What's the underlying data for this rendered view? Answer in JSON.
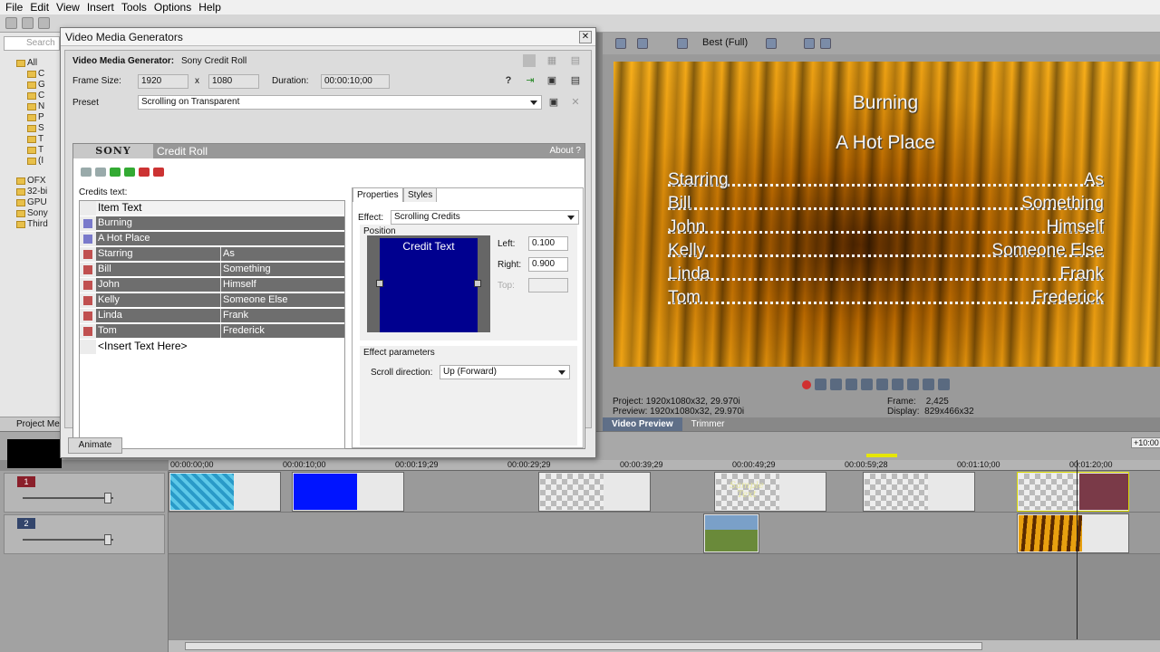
{
  "menu": [
    "File",
    "Edit",
    "View",
    "Insert",
    "Tools",
    "Options",
    "Help"
  ],
  "explorer": {
    "search_placeholder": "Search",
    "items": [
      "All",
      "C",
      "G",
      "C",
      "N",
      "P",
      "S",
      "T",
      "T",
      "(I",
      "OFX",
      "32-bi",
      "GPU",
      "Sony",
      "Third"
    ],
    "tab": "Project Me"
  },
  "dialog": {
    "title": "Video Media Generators",
    "generator_label": "Video Media Generator:",
    "generator_name": "Sony Credit Roll",
    "frame_size_label": "Frame Size:",
    "frame_w": "1920",
    "x_label": "x",
    "frame_h": "1080",
    "duration_label": "Duration:",
    "duration": "00:00:10;00",
    "preset_label": "Preset",
    "preset": "Scrolling on Transparent",
    "sony_logo": "SONY",
    "plugin_name": "Credit Roll",
    "about": "About ?",
    "credits_text_label": "Credits text:",
    "credits_header": "Item Text",
    "credits": [
      {
        "type": "title",
        "text": "Burning"
      },
      {
        "type": "title",
        "text": "A Hot Place"
      },
      {
        "type": "pair",
        "left": "Starring",
        "right": "As"
      },
      {
        "type": "pair",
        "left": "Bill",
        "right": "Something"
      },
      {
        "type": "pair",
        "left": "John",
        "right": "Himself"
      },
      {
        "type": "pair",
        "left": "Kelly",
        "right": "Someone Else"
      },
      {
        "type": "pair",
        "left": "Linda",
        "right": "Frank"
      },
      {
        "type": "pair",
        "left": "Tom",
        "right": "Frederick"
      }
    ],
    "insert_placeholder": "<Insert Text Here>",
    "tabs": [
      "Properties",
      "Styles"
    ],
    "effect_label": "Effect:",
    "effect_value": "Scrolling Credits",
    "position_label": "Position",
    "position_box_text": "Credit Text",
    "left_label": "Left:",
    "left_value": "0.100",
    "right_label": "Right:",
    "right_value": "0.900",
    "top_label": "Top:",
    "effect_params_label": "Effect parameters",
    "scroll_dir_label": "Scroll direction:",
    "scroll_dir_value": "Up (Forward)",
    "animate": "Animate"
  },
  "preview": {
    "quality": "Best (Full)",
    "title1": "Burning",
    "title2": "A Hot Place",
    "rows": [
      {
        "name": "Starring",
        "role": "As"
      },
      {
        "name": "Bill",
        "role": "Something"
      },
      {
        "name": "John",
        "role": "Himself"
      },
      {
        "name": "Kelly",
        "role": "Someone Else"
      },
      {
        "name": "Linda",
        "role": "Frank"
      },
      {
        "name": "Tom",
        "role": "Frederick"
      }
    ],
    "project_label": "Project:",
    "project_value": "1920x1080x32, 29.970i",
    "preview_label": "Preview:",
    "preview_value": "1920x1080x32, 29.970i",
    "frame_label": "Frame:",
    "frame_value": "2,425",
    "display_label": "Display:",
    "display_value": "829x466x32",
    "tabs": [
      "Video Preview",
      "Trimmer"
    ]
  },
  "timeline": {
    "ruler": [
      "00:00:00;00",
      "00:00:10;00",
      "00:00:19;29",
      "00:00:29;29",
      "00:00:39;29",
      "00:00:49;29",
      "00:00:59;28",
      "00:01:10;00",
      "00:01:20;00"
    ],
    "rate": "+10:00",
    "track1": "1",
    "track2": "2",
    "sample_text": "Sample Text"
  },
  "colors": {
    "track1": "#8a1f2a",
    "track2": "#33456b",
    "credit_row_bg": "#6e6e6e",
    "position_blue": "#00008f"
  }
}
